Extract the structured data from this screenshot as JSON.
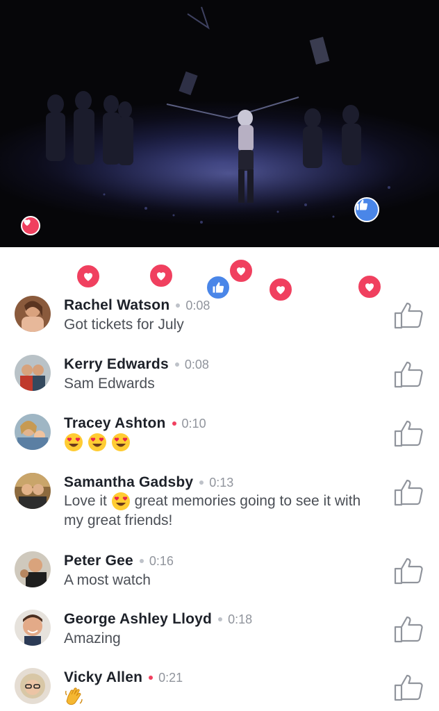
{
  "video": {
    "label": "live video stage",
    "colors": {
      "stage": "#1a1c3e",
      "spotlight": "#2f3470"
    }
  },
  "reactions": {
    "heart_color": "#f0405f",
    "like_color": "#4a86e8"
  },
  "comments": [
    {
      "name": "Rachel Watson",
      "time": "0:08",
      "live": false,
      "text": "Got tickets for July"
    },
    {
      "name": "Kerry Edwards",
      "time": "0:08",
      "live": false,
      "text": "Sam Edwards"
    },
    {
      "name": "Tracey Ashton",
      "time": "0:10",
      "live": true,
      "text": "",
      "emoji": "heart-eyes-emoji x3"
    },
    {
      "name": "Samantha Gadsby",
      "time": "0:13",
      "live": false,
      "text_a": "Love it",
      "text_b": "great memories going to see it with my great friends!",
      "emoji": "heart-eyes-emoji"
    },
    {
      "name": "Peter Gee",
      "time": "0:16",
      "live": false,
      "text": "A most watch"
    },
    {
      "name": "George Ashley Lloyd",
      "time": "0:18",
      "live": false,
      "text": "Amazing"
    },
    {
      "name": "Vicky Allen",
      "time": "0:21",
      "live": true,
      "text": "",
      "emoji": "waving-hand-emoji"
    }
  ],
  "dot_colors": {
    "live": "#f0405f",
    "normal": "#bec2c9"
  },
  "icons": {
    "like_button": "thumbs-up-outline-icon"
  }
}
